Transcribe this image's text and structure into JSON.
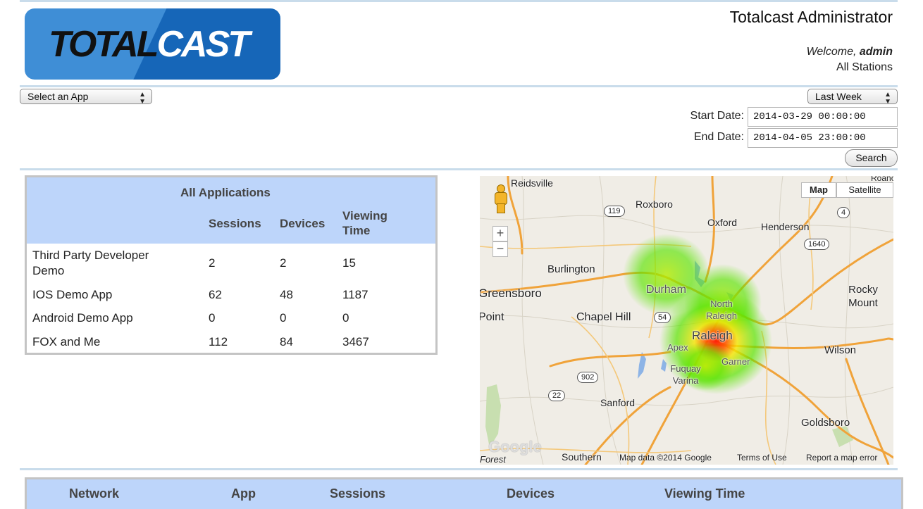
{
  "header": {
    "logo_total": "TOTAL",
    "logo_cast": "CAST",
    "title": "Totalcast Administrator",
    "welcome_prefix": "Welcome, ",
    "username": "admin",
    "scope": "All Stations"
  },
  "filters": {
    "app_select": "Select an App",
    "range_select": "Last Week",
    "start_label": "Start Date:",
    "start_value": "2014-03-29 00:00:00",
    "end_label": "End Date:",
    "end_value": "2014-04-05 23:00:00",
    "search_label": "Search"
  },
  "apps_table": {
    "title": "All Applications",
    "columns": [
      "Sessions",
      "Devices",
      "Viewing Time"
    ],
    "rows": [
      {
        "name": "Third Party Developer Demo",
        "sessions": "2",
        "devices": "2",
        "viewing": "15"
      },
      {
        "name": "IOS Demo App",
        "sessions": "62",
        "devices": "48",
        "viewing": "1187"
      },
      {
        "name": "Android Demo App",
        "sessions": "0",
        "devices": "0",
        "viewing": "0"
      },
      {
        "name": "FOX and Me",
        "sessions": "112",
        "devices": "84",
        "viewing": "3467"
      }
    ]
  },
  "map": {
    "type_map": "Map",
    "type_satellite": "Satellite",
    "zoom_in": "+",
    "zoom_out": "−",
    "places": [
      "Reidsville",
      "Roxboro",
      "Oxford",
      "Henderson",
      "Burlington",
      "Greensboro",
      "Durham",
      "North Raleigh",
      "Raleigh",
      "Chapel Hill",
      "Rocky Mount",
      "Apex",
      "Garner",
      "Fuquay Varina",
      "Wilson",
      "Sanford",
      "Goldsboro",
      "Southern",
      "Forest",
      "Point",
      "Roano"
    ],
    "shields": [
      "119",
      "4",
      "1640",
      "54",
      "902",
      "22"
    ],
    "google": "Google",
    "attribution": "Map data ©2014 Google",
    "terms": "Terms of Use",
    "report": "Report a map error",
    "colors": {
      "heat_core": "#ff1a00",
      "heat_mid": "#f5e600",
      "heat_outer": "#5ae400",
      "roads": "#f0a33a",
      "water": "#8db4e6"
    }
  },
  "network_table": {
    "columns": [
      "Network",
      "App",
      "Sessions",
      "Devices",
      "Viewing Time"
    ]
  }
}
